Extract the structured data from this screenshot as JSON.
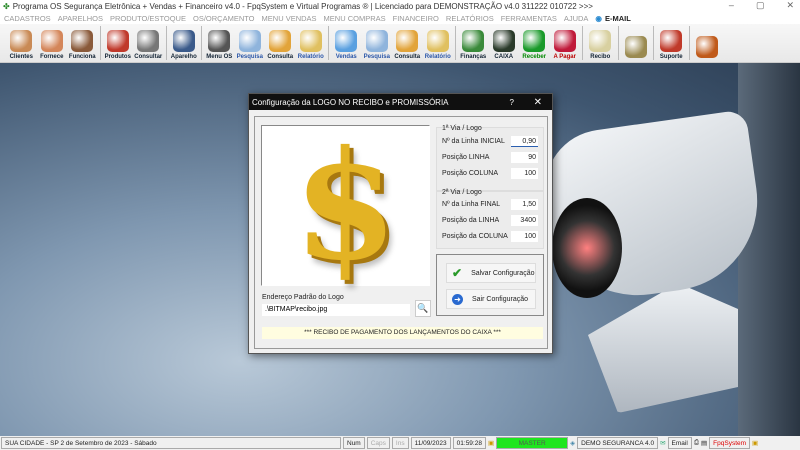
{
  "window": {
    "title": "Programa OS Segurança Eletrônica + Vendas + Financeiro v4.0 - FpqSystem e Virtual Programas ® | Licenciado para  DEMONSTRAÇÃO v4.0 311222 010722 >>>",
    "minimize": "–",
    "maximize": "▢",
    "close": "✕"
  },
  "menu": [
    "CADASTROS",
    "APARELHOS",
    "PRODUTO/ESTOQUE",
    "OS/ORÇAMENTO",
    "MENU VENDAS",
    "MENU COMPRAS",
    "FINANCEIRO",
    "RELATÓRIOS",
    "FERRAMENTAS",
    "AJUDA"
  ],
  "menu_email": "E-MAIL",
  "toolbar": [
    {
      "label": "Clientes",
      "color": "#c98a55",
      "cls": ""
    },
    {
      "label": "Fornece",
      "color": "#d4865a",
      "cls": ""
    },
    {
      "label": "Funciona",
      "color": "#8a5a3a",
      "cls": ""
    },
    {
      "sep": true
    },
    {
      "label": "Produtos",
      "color": "#c0392b",
      "cls": ""
    },
    {
      "label": "Consultar",
      "color": "#777777",
      "cls": ""
    },
    {
      "sep": true
    },
    {
      "label": "Aparelho",
      "color": "#3a5a8a",
      "cls": ""
    },
    {
      "sep": true
    },
    {
      "label": "Menu OS",
      "color": "#555555",
      "cls": ""
    },
    {
      "label": "Pesquisa",
      "color": "#8fb4dc",
      "cls": "blue"
    },
    {
      "label": "Consulta",
      "color": "#e2a43a",
      "cls": ""
    },
    {
      "label": "Relatório",
      "color": "#e0c060",
      "cls": "blue"
    },
    {
      "sep": true
    },
    {
      "label": "Vendas",
      "color": "#5aa0e0",
      "cls": "blue"
    },
    {
      "label": "Pesquisa",
      "color": "#8fb4dc",
      "cls": "blue"
    },
    {
      "label": "Consulta",
      "color": "#e2a43a",
      "cls": ""
    },
    {
      "label": "Relatório",
      "color": "#e0c060",
      "cls": "blue"
    },
    {
      "sep": true
    },
    {
      "label": "Finanças",
      "color": "#3a8a3a",
      "cls": ""
    },
    {
      "label": "CAIXA",
      "color": "#2a3a2a",
      "cls": ""
    },
    {
      "label": "Receber",
      "color": "#1a9a2a",
      "cls": "green"
    },
    {
      "label": "A Pagar",
      "color": "#c01a3a",
      "cls": "red"
    },
    {
      "sep": true
    },
    {
      "label": "Recibo",
      "color": "#d8d0a0",
      "cls": ""
    },
    {
      "sep": true
    },
    {
      "label": "",
      "color": "#9a8a50",
      "cls": ""
    },
    {
      "sep": true
    },
    {
      "label": "Suporte",
      "color": "#c03a2a",
      "cls": ""
    },
    {
      "sep": true
    },
    {
      "label": "",
      "color": "#c05a1a",
      "cls": ""
    }
  ],
  "dialog": {
    "title": "Configuração da LOGO NO RECIBO e PROMISSÓRIA",
    "help": "?",
    "close": "✕",
    "group1": {
      "title": "1ª Via / Logo",
      "rows": [
        {
          "label": "Nº da Linha INICIAL",
          "value": "0,90"
        },
        {
          "label": "Posição LINHA",
          "value": "90"
        },
        {
          "label": "Posição COLUNA",
          "value": "100"
        }
      ]
    },
    "group2": {
      "title": "2ª Via / Logo",
      "rows": [
        {
          "label": "Nº da Linha FINAL",
          "value": "1,50"
        },
        {
          "label": "Posição da LINHA",
          "value": "3400"
        },
        {
          "label": "Posição da COLUNA",
          "value": "100"
        }
      ]
    },
    "save_label": "Salvar Configuração",
    "exit_label": "Sair Configuração",
    "path_label": "Endereço Padrão do Logo",
    "path_value": ".\\BITMAP\\recibo.jpg",
    "banner": "*** RECIBO DE PAGAMENTO DOS LANÇAMENTOS DO CAIXA ***"
  },
  "status": {
    "location": "SUA CIDADE - SP  2 de Setembro de 2023 - Sábado",
    "num": "Num",
    "caps": "Caps",
    "ins": "Ins",
    "date": "11/09/2023",
    "time": "01:59:28",
    "user": "MASTER",
    "company": "DEMO SEGURANCA 4.0",
    "email": "Email",
    "brand": "FpqSystem"
  }
}
